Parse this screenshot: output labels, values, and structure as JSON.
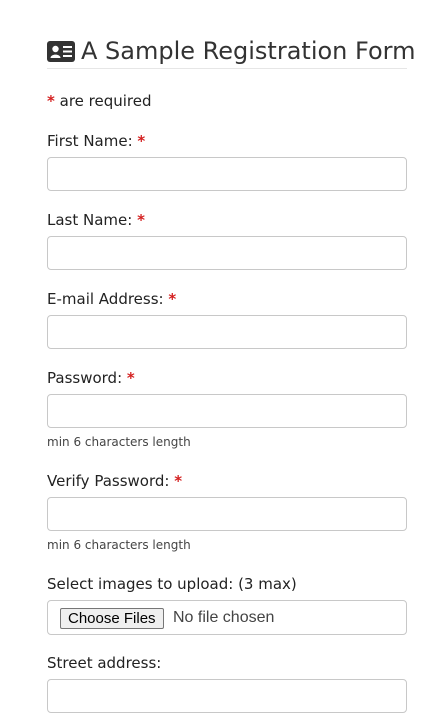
{
  "header": {
    "title": "A Sample Registration Form",
    "icon": "id-card-icon"
  },
  "required_note": {
    "marker": "*",
    "text": " are required"
  },
  "fields": {
    "first_name": {
      "label": "First Name: ",
      "marker": "*",
      "value": ""
    },
    "last_name": {
      "label": "Last Name: ",
      "marker": "*",
      "value": ""
    },
    "email": {
      "label": "E-mail Address: ",
      "marker": "*",
      "value": ""
    },
    "password": {
      "label": "Password: ",
      "marker": "*",
      "value": "",
      "help": "min 6 characters length"
    },
    "verify_password": {
      "label": "Verify Password: ",
      "marker": "*",
      "value": "",
      "help": "min 6 characters length"
    },
    "images": {
      "label": "Select images to upload: (3 max)",
      "button_label": "Choose Files",
      "status": "No file chosen"
    },
    "street": {
      "label": "Street address:",
      "value": ""
    }
  },
  "colors": {
    "required_marker": "#d42020",
    "input_border": "#c8c8c8"
  }
}
